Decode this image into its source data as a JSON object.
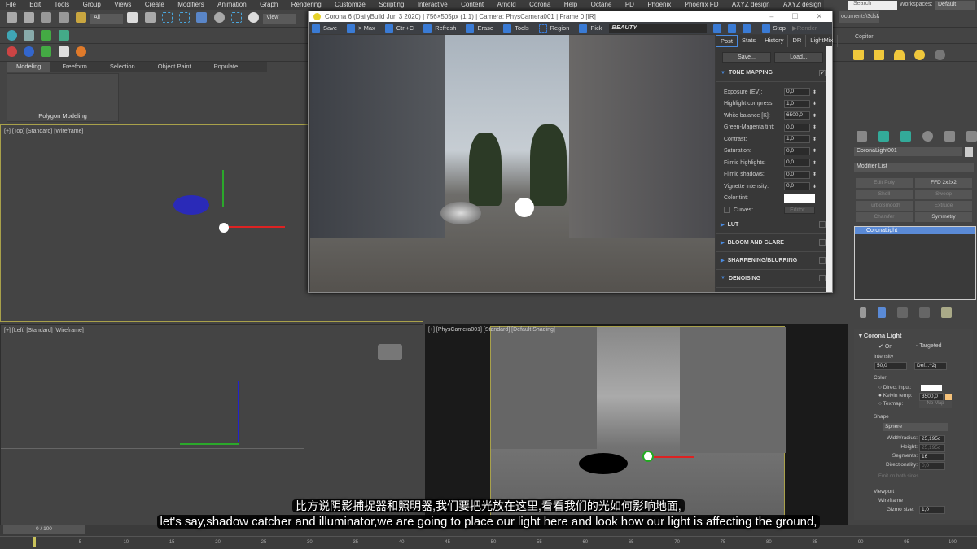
{
  "menu": [
    "File",
    "Edit",
    "Tools",
    "Group",
    "Views",
    "Create",
    "Modifiers",
    "Animation",
    "Graph",
    "Rendering",
    "Customize",
    "Scripting",
    "Interactive",
    "Content",
    "Arnold",
    "Corona",
    "Help",
    "Octane",
    "PD",
    "Phoenix",
    "Phoenix FD",
    "AXYZ design",
    "AXYZ design"
  ],
  "toolbar": {
    "filter": "All",
    "view": "View",
    "search_placeholder": "Search",
    "workspaces_label": "Workspaces:",
    "workspace": "Default",
    "path": "ocuments\\3dsMax",
    "copitor": "Copitor"
  },
  "ribbon": {
    "tabs": [
      "Modeling",
      "Freeform",
      "Selection",
      "Object Paint",
      "Populate"
    ],
    "panel": "Polygon Modeling"
  },
  "viewports": {
    "top": "[+] [Top] [Standard] [Wireframe]",
    "left": "[+] [Left] [Standard] [Wireframe]",
    "camera": "[+] [PhysCamera001] [Standard] [Default Shading]"
  },
  "corona": {
    "title": "Corona 6 (DailyBuild Jun  3 2020) | 756×505px (1:1) | Camera: PhysCamera001 | Frame 0 [IR]",
    "toolbar": [
      "Save",
      "> Max",
      "Ctrl+C",
      "Refresh",
      "Erase",
      "Tools",
      "Region",
      "Pick"
    ],
    "channel": "BEAUTY",
    "stop": "Stop",
    "render": "Render",
    "tabs": [
      "Post",
      "Stats",
      "History",
      "DR",
      "LightMix"
    ],
    "save": "Save...",
    "load": "Load...",
    "tone_mapping": "TONE MAPPING",
    "params": [
      {
        "label": "Exposure (EV):",
        "value": "0,0"
      },
      {
        "label": "Highlight compress:",
        "value": "1,0"
      },
      {
        "label": "White balance [K]:",
        "value": "6500,0"
      },
      {
        "label": "Green-Magenta tint:",
        "value": "0,0"
      },
      {
        "label": "Contrast:",
        "value": "1,0"
      },
      {
        "label": "Saturation:",
        "value": "0,0"
      },
      {
        "label": "Filmic highlights:",
        "value": "0,0"
      },
      {
        "label": "Filmic shadows:",
        "value": "0,0"
      },
      {
        "label": "Vignette intensity:",
        "value": "0,0"
      }
    ],
    "color_tint": "Color tint:",
    "curves": "Curves:",
    "editor": "Editor...",
    "sections": [
      "LUT",
      "BLOOM AND GLARE",
      "SHARPENING/BLURRING",
      "DENOISING"
    ],
    "accent": "#3a7bd5"
  },
  "command": {
    "object_name": "CoronaLight001",
    "modifier_list": "Modifier List",
    "modifiers": [
      "Edit Poly",
      "FFD 2x2x2",
      "Shell",
      "Sweep",
      "TurboSmooth",
      "Extrude",
      "Chamfer",
      "Symmetry"
    ],
    "stack_item": "CoronaLight",
    "rollout": "Corona Light",
    "on": "On",
    "targeted": "Targeted",
    "intensity_label": "Intensity",
    "intensity": "50,0",
    "unit": "Def...^2)",
    "color_label": "Color",
    "direct_input": "Direct input:",
    "kelvin": "Kelvin temp:",
    "kelvin_value": "3500,0",
    "texmap": "Texmap:",
    "no_map": "No Map",
    "shape_label": "Shape",
    "shape": "Sphere",
    "width_radius": "Width/radius:",
    "width_value": "25,195c",
    "height": "Height:",
    "height_value": "25,195c",
    "segments": "Segments:",
    "segments_value": "16",
    "directionality": "Directionality:",
    "directionality_value": "0,0",
    "emit": "Emit on both sides",
    "viewport_label": "Viewport",
    "wireframe": "Wireframe",
    "gizmo": "Gizmo size:",
    "gizmo_value": "1,0"
  },
  "timeline": {
    "frame": "0 / 100",
    "ticks": [
      "5",
      "10",
      "15",
      "20",
      "25",
      "30",
      "35",
      "40",
      "45",
      "50",
      "55",
      "60",
      "65",
      "70",
      "75",
      "80",
      "85",
      "90",
      "95",
      "100"
    ]
  },
  "subtitles": {
    "zh": "比方说阴影捕捉器和照明器,我们要把光放在这里,看看我们的光如何影响地面,",
    "en": "let's say,shadow catcher and illuminator,we are going to place our light here and look how our light is affecting the ground,"
  }
}
